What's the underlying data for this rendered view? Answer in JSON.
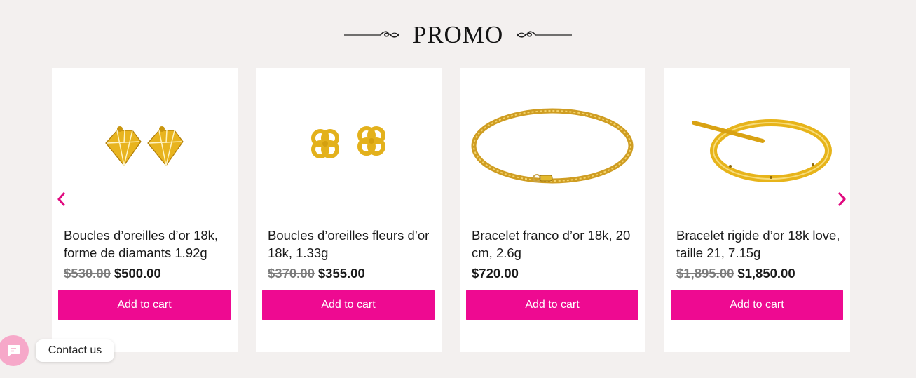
{
  "section": {
    "title": "PROMO"
  },
  "colors": {
    "accent": "#ee0a91",
    "background": "#f3f0ef",
    "gold": "#e5b522"
  },
  "products": [
    {
      "title": "Boucles d’oreilles d’or 18k, forme de diamants 1.92g",
      "old_price": "$530.00",
      "price": "$500.00",
      "cta": "Add to cart",
      "image_icon": "diamond-earrings-image"
    },
    {
      "title": "Boucles d’oreilles fleurs d’or 18k, 1.33g",
      "old_price": "$370.00",
      "price": "$355.00",
      "cta": "Add to cart",
      "image_icon": "flower-earrings-image"
    },
    {
      "title": "Bracelet franco d’or 18k, 20 cm, 2.6g",
      "old_price": "",
      "price": "$720.00",
      "cta": "Add to cart",
      "image_icon": "chain-bracelet-image"
    },
    {
      "title": "Bracelet rigide d’or 18k love, taille 21, 7.15g",
      "old_price": "$1,895.00",
      "price": "$1,850.00",
      "cta": "Add to cart",
      "image_icon": "bangle-bracelet-image"
    }
  ],
  "carousel": {
    "prev_icon": "chevron-left-icon",
    "next_icon": "chevron-right-icon"
  },
  "contact": {
    "label": "Contact us",
    "icon": "chat-icon"
  }
}
